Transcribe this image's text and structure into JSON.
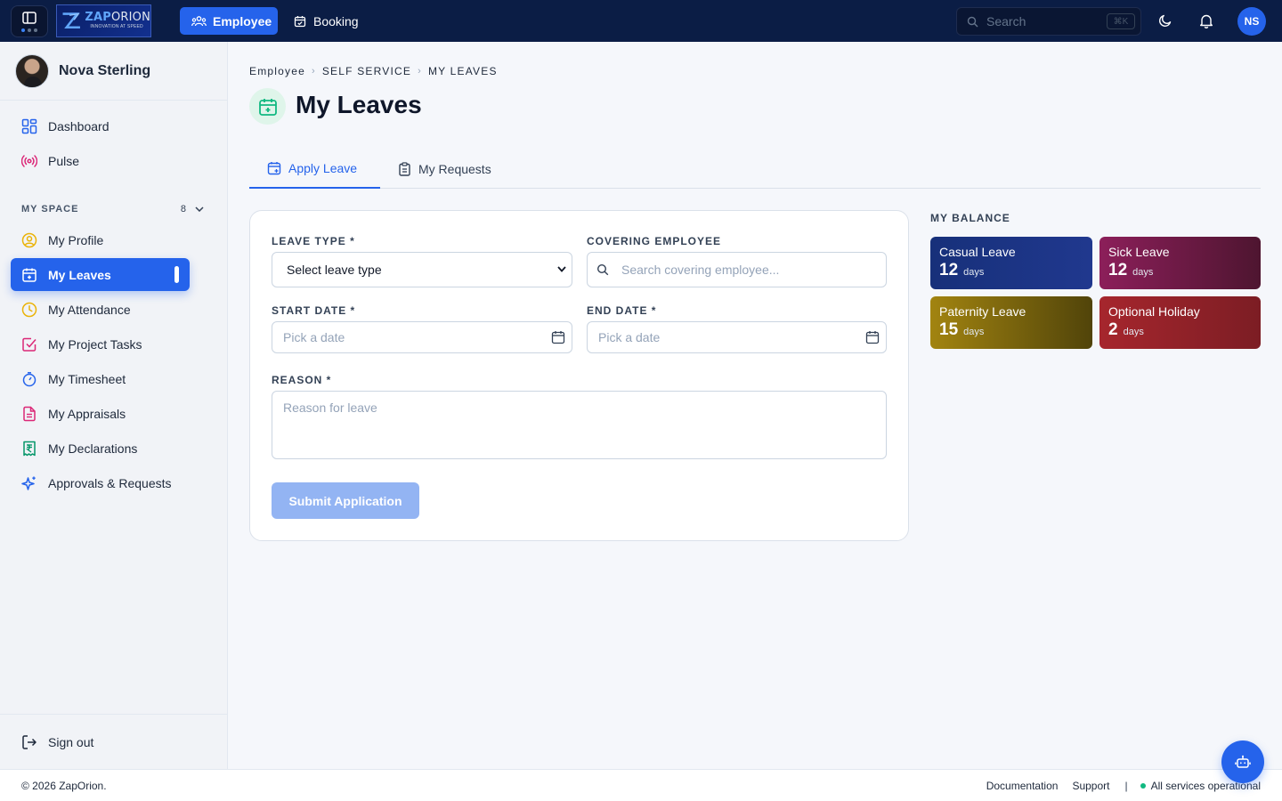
{
  "topbar": {
    "logo_name_a": "ZAP",
    "logo_name_b": "ORION",
    "logo_tagline": "INNOVATION AT SPEED",
    "nav": [
      {
        "label": "Employee",
        "icon": "users-icon",
        "active": true
      },
      {
        "label": "Booking",
        "icon": "calendar-check-icon",
        "active": false
      }
    ],
    "search_placeholder": "Search",
    "search_shortcut": "⌘K",
    "user_initials": "NS"
  },
  "sidebar": {
    "user_name": "Nova Sterling",
    "top_items": [
      {
        "label": "Dashboard",
        "icon": "grid-icon"
      },
      {
        "label": "Pulse",
        "icon": "broadcast-icon"
      }
    ],
    "section": {
      "title": "MY SPACE",
      "count": "8"
    },
    "items": [
      {
        "label": "My Profile",
        "icon": "user-circle-icon"
      },
      {
        "label": "My Leaves",
        "icon": "calendar-plus-icon",
        "active": true
      },
      {
        "label": "My Attendance",
        "icon": "clock-icon"
      },
      {
        "label": "My Project Tasks",
        "icon": "check-square-icon"
      },
      {
        "label": "My Timesheet",
        "icon": "timer-icon"
      },
      {
        "label": "My Appraisals",
        "icon": "file-text-icon"
      },
      {
        "label": "My Declarations",
        "icon": "rupee-receipt-icon"
      },
      {
        "label": "Approvals & Requests",
        "icon": "sparkle-icon"
      }
    ],
    "sign_out": "Sign out"
  },
  "breadcrumb": [
    "Employee",
    "SELF SERVICE",
    "MY LEAVES"
  ],
  "page_title": "My Leaves",
  "tabs": [
    {
      "label": "Apply Leave",
      "active": true
    },
    {
      "label": "My Requests",
      "active": false
    }
  ],
  "form": {
    "leave_type_label": "LEAVE TYPE *",
    "leave_type_value": "Select leave type",
    "covering_label": "COVERING EMPLOYEE",
    "covering_placeholder": "Search covering employee...",
    "start_label": "START DATE *",
    "start_placeholder": "Pick a date",
    "end_label": "END DATE *",
    "end_placeholder": "Pick a date",
    "reason_label": "REASON *",
    "reason_placeholder": "Reason for leave",
    "submit_label": "Submit Application"
  },
  "balance": {
    "title": "MY BALANCE",
    "unit": "days",
    "items": [
      {
        "name": "Casual Leave",
        "value": "12"
      },
      {
        "name": "Sick Leave",
        "value": "12"
      },
      {
        "name": "Paternity Leave",
        "value": "15"
      },
      {
        "name": "Optional Holiday",
        "value": "2"
      }
    ]
  },
  "footer": {
    "copyright": "© 2026 ZapOrion.",
    "documentation": "Documentation",
    "support": "Support",
    "status": "All services operational"
  },
  "colors": {
    "brand": "#2563eb",
    "topbar": "#0b1d45",
    "status_ok": "#10b981"
  }
}
